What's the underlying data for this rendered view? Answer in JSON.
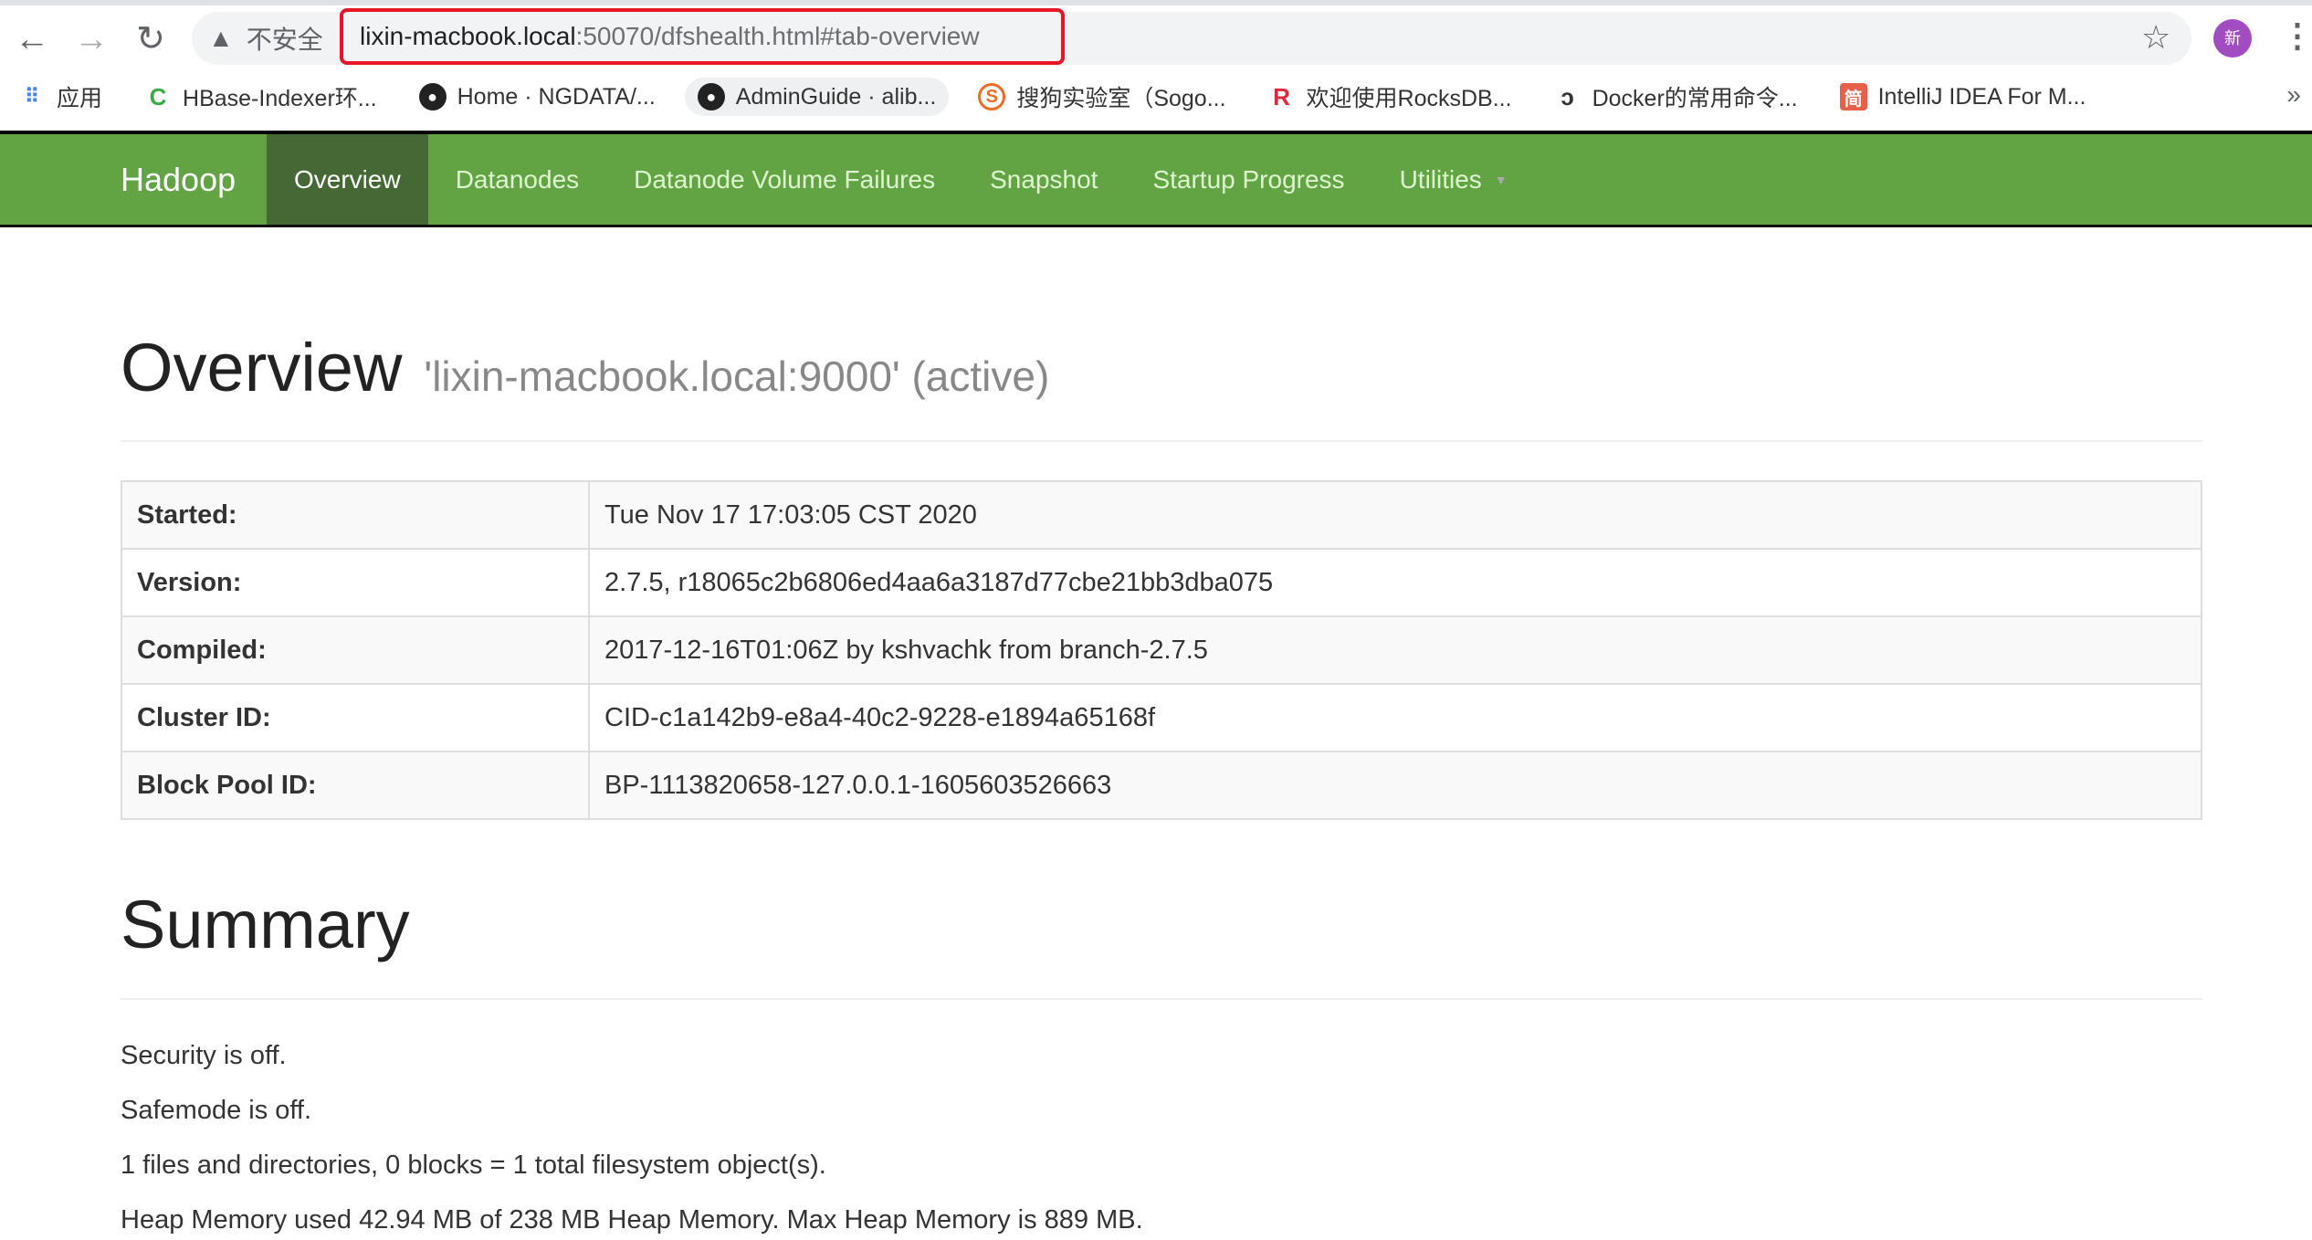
{
  "browser": {
    "security_label": "不安全",
    "url_host": "lixin-macbook.local",
    "url_rest": ":50070/dfshealth.html#tab-overview",
    "avatar_text": "新",
    "highlight_color": "#e8142a",
    "bookmarks": [
      {
        "label": "应用",
        "icon": "apps-grid-icon"
      },
      {
        "label": "HBase-Indexer环...",
        "icon": "c-logo-icon"
      },
      {
        "label": "Home · NGDATA/...",
        "icon": "github-icon"
      },
      {
        "label": "AdminGuide · alib...",
        "icon": "github-icon"
      },
      {
        "label": "搜狗实验室（Sogo...",
        "icon": "sogou-icon"
      },
      {
        "label": "欢迎使用RocksDB...",
        "icon": "rocksdb-icon"
      },
      {
        "label": "Docker的常用命令...",
        "icon": "docker-blog-icon"
      },
      {
        "label": "IntelliJ IDEA For M...",
        "icon": "jianshu-icon"
      }
    ]
  },
  "navbar": {
    "brand": "Hadoop",
    "color": "#62a444",
    "items": [
      {
        "label": "Overview",
        "active": true
      },
      {
        "label": "Datanodes"
      },
      {
        "label": "Datanode Volume Failures"
      },
      {
        "label": "Snapshot"
      },
      {
        "label": "Startup Progress"
      },
      {
        "label": "Utilities",
        "dropdown": true
      }
    ]
  },
  "overview": {
    "title": "Overview",
    "subtitle": "'lixin-macbook.local:9000' (active)",
    "rows": [
      {
        "key": "Started:",
        "value": "Tue Nov 17 17:03:05 CST 2020"
      },
      {
        "key": "Version:",
        "value": "2.7.5, r18065c2b6806ed4aa6a3187d77cbe21bb3dba075"
      },
      {
        "key": "Compiled:",
        "value": "2017-12-16T01:06Z by kshvachk from branch-2.7.5"
      },
      {
        "key": "Cluster ID:",
        "value": "CID-c1a142b9-e8a4-40c2-9228-e1894a65168f"
      },
      {
        "key": "Block Pool ID:",
        "value": "BP-1113820658-127.0.0.1-1605603526663"
      }
    ]
  },
  "summary": {
    "title": "Summary",
    "lines": [
      "Security is off.",
      "Safemode is off.",
      "1 files and directories, 0 blocks = 1 total filesystem object(s).",
      "Heap Memory used 42.94 MB of 238 MB Heap Memory. Max Heap Memory is 889 MB."
    ]
  }
}
